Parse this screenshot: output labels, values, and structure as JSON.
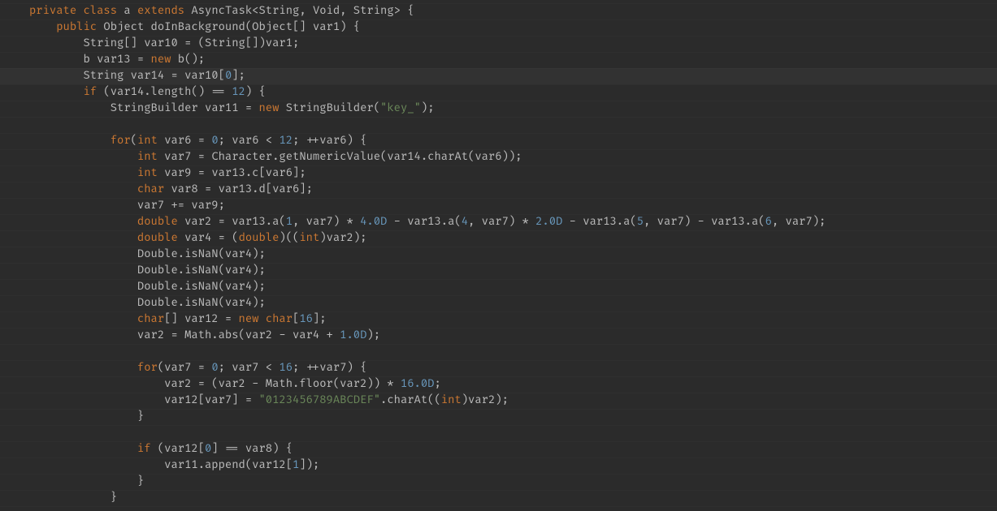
{
  "code": {
    "lines": [
      {
        "indent": 0,
        "tokens": [
          [
            "kw",
            "private"
          ],
          [
            "punct",
            " "
          ],
          [
            "kw",
            "class"
          ],
          [
            "punct",
            " a "
          ],
          [
            "kw",
            "extends"
          ],
          [
            "punct",
            " AsyncTask<String, Void, String> {"
          ]
        ]
      },
      {
        "indent": 1,
        "tokens": [
          [
            "kw",
            "public"
          ],
          [
            "punct",
            " Object doInBackground(Object[] var1) {"
          ]
        ]
      },
      {
        "indent": 2,
        "tokens": [
          [
            "punct",
            "String[] var10 = (String[])var1;"
          ]
        ]
      },
      {
        "indent": 2,
        "tokens": [
          [
            "punct",
            "b var13 = "
          ],
          [
            "kw",
            "new"
          ],
          [
            "punct",
            " b();"
          ]
        ]
      },
      {
        "indent": 2,
        "hl": true,
        "tokens": [
          [
            "punct",
            "String var14 = var10["
          ],
          [
            "num",
            "0"
          ],
          [
            "punct",
            "];"
          ]
        ]
      },
      {
        "indent": 2,
        "tokens": [
          [
            "kw",
            "if"
          ],
          [
            "punct",
            " (var14.length() == "
          ],
          [
            "num",
            "12"
          ],
          [
            "punct",
            ") {"
          ]
        ]
      },
      {
        "indent": 3,
        "tokens": [
          [
            "punct",
            "StringBuilder var11 = "
          ],
          [
            "kw",
            "new"
          ],
          [
            "punct",
            " StringBuilder("
          ],
          [
            "str",
            "\"key_\""
          ],
          [
            "punct",
            ");"
          ]
        ]
      },
      {
        "indent": 0,
        "tokens": [
          [
            "punct",
            ""
          ]
        ]
      },
      {
        "indent": 3,
        "tokens": [
          [
            "kw",
            "for"
          ],
          [
            "punct",
            "("
          ],
          [
            "kw",
            "int"
          ],
          [
            "punct",
            " var6 = "
          ],
          [
            "num",
            "0"
          ],
          [
            "punct",
            "; var6 < "
          ],
          [
            "num",
            "12"
          ],
          [
            "punct",
            "; ++var6) {"
          ]
        ]
      },
      {
        "indent": 4,
        "tokens": [
          [
            "kw",
            "int"
          ],
          [
            "punct",
            " var7 = Character.getNumericValue(var14.charAt(var6));"
          ]
        ]
      },
      {
        "indent": 4,
        "tokens": [
          [
            "kw",
            "int"
          ],
          [
            "punct",
            " var9 = var13.c[var6];"
          ]
        ]
      },
      {
        "indent": 4,
        "tokens": [
          [
            "kw",
            "char"
          ],
          [
            "punct",
            " var8 = var13.d[var6];"
          ]
        ]
      },
      {
        "indent": 4,
        "tokens": [
          [
            "punct",
            "var7 += var9;"
          ]
        ]
      },
      {
        "indent": 4,
        "tokens": [
          [
            "kw",
            "double"
          ],
          [
            "punct",
            " var2 = var13.a("
          ],
          [
            "num",
            "1"
          ],
          [
            "punct",
            ", var7) * "
          ],
          [
            "num",
            "4.0D"
          ],
          [
            "punct",
            " - var13.a("
          ],
          [
            "num",
            "4"
          ],
          [
            "punct",
            ", var7) * "
          ],
          [
            "num",
            "2.0D"
          ],
          [
            "punct",
            " - var13.a("
          ],
          [
            "num",
            "5"
          ],
          [
            "punct",
            ", var7) - var13.a("
          ],
          [
            "num",
            "6"
          ],
          [
            "punct",
            ", var7);"
          ]
        ]
      },
      {
        "indent": 4,
        "tokens": [
          [
            "kw",
            "double"
          ],
          [
            "punct",
            " var4 = ("
          ],
          [
            "kw",
            "double"
          ],
          [
            "punct",
            ")(("
          ],
          [
            "kw",
            "int"
          ],
          [
            "punct",
            ")var2);"
          ]
        ]
      },
      {
        "indent": 4,
        "tokens": [
          [
            "punct",
            "Double.isNaN(var4);"
          ]
        ]
      },
      {
        "indent": 4,
        "tokens": [
          [
            "punct",
            "Double.isNaN(var4);"
          ]
        ]
      },
      {
        "indent": 4,
        "tokens": [
          [
            "punct",
            "Double.isNaN(var4);"
          ]
        ]
      },
      {
        "indent": 4,
        "tokens": [
          [
            "punct",
            "Double.isNaN(var4);"
          ]
        ]
      },
      {
        "indent": 4,
        "tokens": [
          [
            "kw",
            "char"
          ],
          [
            "punct",
            "[] var12 = "
          ],
          [
            "kw",
            "new"
          ],
          [
            "punct",
            " "
          ],
          [
            "kw",
            "char"
          ],
          [
            "punct",
            "["
          ],
          [
            "num",
            "16"
          ],
          [
            "punct",
            "];"
          ]
        ]
      },
      {
        "indent": 4,
        "tokens": [
          [
            "punct",
            "var2 = Math.abs(var2 - var4 + "
          ],
          [
            "num",
            "1.0D"
          ],
          [
            "punct",
            ");"
          ]
        ]
      },
      {
        "indent": 0,
        "tokens": [
          [
            "punct",
            ""
          ]
        ]
      },
      {
        "indent": 4,
        "tokens": [
          [
            "kw",
            "for"
          ],
          [
            "punct",
            "(var7 = "
          ],
          [
            "num",
            "0"
          ],
          [
            "punct",
            "; var7 < "
          ],
          [
            "num",
            "16"
          ],
          [
            "punct",
            "; ++var7) {"
          ]
        ]
      },
      {
        "indent": 5,
        "tokens": [
          [
            "punct",
            "var2 = (var2 - Math.floor(var2)) * "
          ],
          [
            "num",
            "16.0D"
          ],
          [
            "punct",
            ";"
          ]
        ]
      },
      {
        "indent": 5,
        "tokens": [
          [
            "punct",
            "var12[var7] = "
          ],
          [
            "str",
            "\"0123456789ABCDEF\""
          ],
          [
            "punct",
            ".charAt(("
          ],
          [
            "kw",
            "int"
          ],
          [
            "punct",
            ")var2);"
          ]
        ]
      },
      {
        "indent": 4,
        "tokens": [
          [
            "punct",
            "}"
          ]
        ]
      },
      {
        "indent": 0,
        "tokens": [
          [
            "punct",
            ""
          ]
        ]
      },
      {
        "indent": 4,
        "tokens": [
          [
            "kw",
            "if"
          ],
          [
            "punct",
            " (var12["
          ],
          [
            "num",
            "0"
          ],
          [
            "punct",
            "] == var8) {"
          ]
        ]
      },
      {
        "indent": 5,
        "tokens": [
          [
            "punct",
            "var11.append(var12["
          ],
          [
            "num",
            "1"
          ],
          [
            "punct",
            "]);"
          ]
        ]
      },
      {
        "indent": 4,
        "tokens": [
          [
            "punct",
            "}"
          ]
        ]
      },
      {
        "indent": 3,
        "tokens": [
          [
            "punct",
            "}"
          ]
        ]
      }
    ]
  }
}
